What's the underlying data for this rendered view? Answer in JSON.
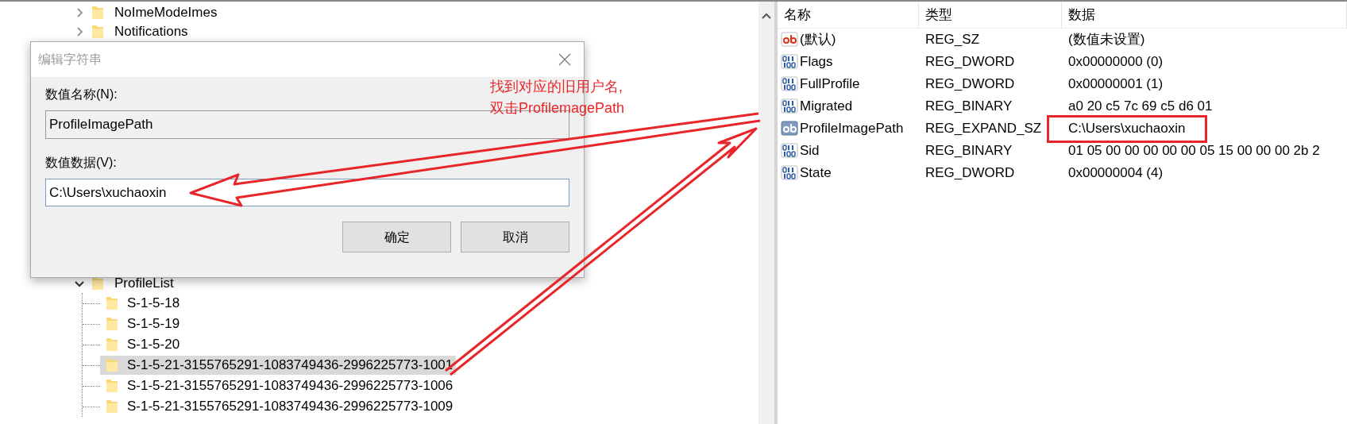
{
  "tree": {
    "items": [
      {
        "label": "NoImeModeImes",
        "expanded": false
      },
      {
        "label": "Notifications",
        "expanded": false
      },
      {
        "label": "ProfileList",
        "expanded": true,
        "children": [
          {
            "label": "S-1-5-18",
            "selected": false
          },
          {
            "label": "S-1-5-19",
            "selected": false
          },
          {
            "label": "S-1-5-20",
            "selected": false
          },
          {
            "label": "S-1-5-21-3155765291-1083749436-2996225773-1001",
            "selected": true
          },
          {
            "label": "S-1-5-21-3155765291-1083749436-2996225773-1006",
            "selected": false
          },
          {
            "label": "S-1-5-21-3155765291-1083749436-2996225773-1009",
            "selected": false
          }
        ]
      }
    ]
  },
  "values": {
    "columns": [
      "名称",
      "类型",
      "数据"
    ],
    "rows": [
      {
        "kind": "string",
        "name": "(默认)",
        "type": "REG_SZ",
        "data": "(数值未设置)"
      },
      {
        "kind": "binary",
        "name": "Flags",
        "type": "REG_DWORD",
        "data": "0x00000000 (0)"
      },
      {
        "kind": "binary",
        "name": "FullProfile",
        "type": "REG_DWORD",
        "data": "0x00000001 (1)"
      },
      {
        "kind": "binary",
        "name": "Migrated",
        "type": "REG_BINARY",
        "data": "a0 20 c5 7c 69 c5 d6 01"
      },
      {
        "kind": "expand_string",
        "name": "ProfileImagePath",
        "type": "REG_EXPAND_SZ",
        "data": "C:\\Users\\xuchaoxin"
      },
      {
        "kind": "binary",
        "name": "Sid",
        "type": "REG_BINARY",
        "data": "01 05 00 00 00 00 00 05 15 00 00 00 2b 2"
      },
      {
        "kind": "binary",
        "name": "State",
        "type": "REG_DWORD",
        "data": "0x00000004 (4)"
      }
    ]
  },
  "dialog": {
    "title": "编辑字符串",
    "name_label": "数值名称(N):",
    "name_value": "ProfileImagePath",
    "data_label": "数值数据(V):",
    "data_value": "C:\\Users\\xuchaoxin",
    "buttons": [
      "确定",
      "取消"
    ]
  },
  "annotation": {
    "note": [
      "找到对应的旧用户名,",
      "双击ProfilemagePath"
    ]
  }
}
